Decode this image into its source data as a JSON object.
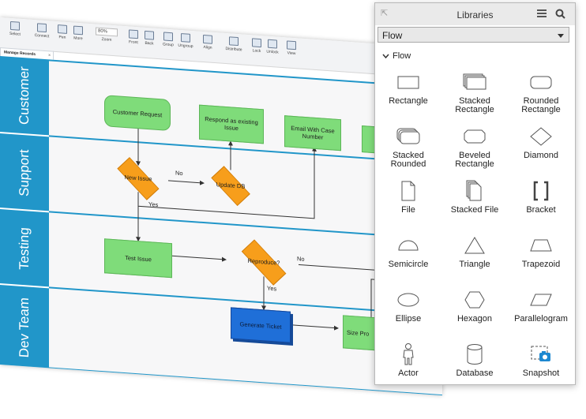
{
  "toolbar": {
    "select": "Select",
    "connect": "Connect",
    "pen": "Pen",
    "more": "More",
    "zoom_value": "80%",
    "zoom_label": "Zoom",
    "front": "Front",
    "back": "Back",
    "group": "Group",
    "ungroup": "Ungroup",
    "align": "Align",
    "distribute": "Distribute",
    "lock": "Lock",
    "unlock": "Unlock",
    "view": "View"
  },
  "document_tab": "Manage Records",
  "lanes": [
    "Customer",
    "Support",
    "Testing",
    "Dev Team"
  ],
  "nodes": {
    "customer_request": "Customer Request",
    "respond_existing": "Respond as existing Issue",
    "email_case": "Email With Case Number",
    "new_issue": "New Issue",
    "update_db": "Update DB",
    "test_issue": "Test Issue",
    "reproduce": "Reproduce?",
    "generate_ticket": "Generate Ticket",
    "size_pro": "Size Pro"
  },
  "connector_labels": {
    "no1": "No",
    "yes1": "Yes",
    "no2": "No",
    "yes2": "Yes"
  },
  "colors": {
    "lane_blue": "#2196c9",
    "process_green": "#7fdc7a",
    "decision_orange": "#f79e1b",
    "ticket_blue": "#1f6fd8"
  },
  "panel": {
    "title": "Libraries",
    "library_select": "Flow",
    "section": "Flow",
    "shapes": [
      {
        "label": "Rectangle",
        "icon": "rectangle-icon"
      },
      {
        "label": "Stacked Rectangle",
        "icon": "stacked-rectangle-icon"
      },
      {
        "label": "Rounded Rectangle",
        "icon": "rounded-rectangle-icon"
      },
      {
        "label": "Stacked Rounded",
        "icon": "stacked-rounded-icon"
      },
      {
        "label": "Beveled Rectangle",
        "icon": "beveled-rectangle-icon"
      },
      {
        "label": "Diamond",
        "icon": "diamond-icon"
      },
      {
        "label": "File",
        "icon": "file-icon"
      },
      {
        "label": "Stacked File",
        "icon": "stacked-file-icon"
      },
      {
        "label": "Bracket",
        "icon": "bracket-icon"
      },
      {
        "label": "Semicircle",
        "icon": "semicircle-icon"
      },
      {
        "label": "Triangle",
        "icon": "triangle-icon"
      },
      {
        "label": "Trapezoid",
        "icon": "trapezoid-icon"
      },
      {
        "label": "Ellipse",
        "icon": "ellipse-icon"
      },
      {
        "label": "Hexagon",
        "icon": "hexagon-icon"
      },
      {
        "label": "Parallelogram",
        "icon": "parallelogram-icon"
      },
      {
        "label": "Actor",
        "icon": "actor-icon"
      },
      {
        "label": "Database",
        "icon": "database-icon"
      },
      {
        "label": "Snapshot",
        "icon": "snapshot-icon"
      }
    ]
  }
}
